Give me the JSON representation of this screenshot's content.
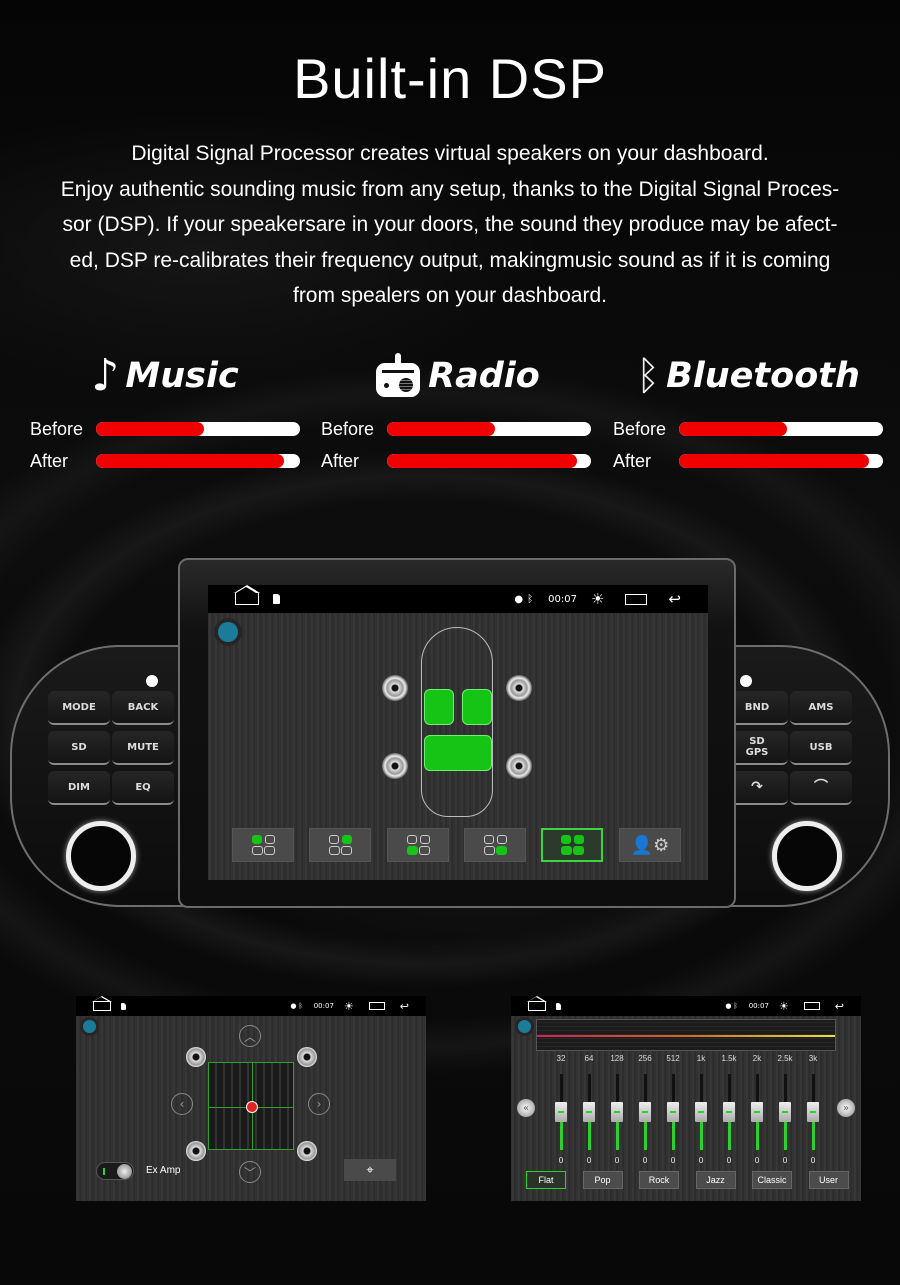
{
  "header": {
    "title": "Built-in DSP",
    "intro_lines": [
      "Digital Signal Processor creates virtual speakers on your dashboard.",
      "Enjoy authentic sounding music from any setup, thanks to the Digital Signal Proces-",
      "sor (DSP).  If your speakersare in your doors, the sound they produce may be afect-",
      "ed, DSP re-calibrates their frequency output, makingmusic sound as if it is coming",
      "from spealers on your dashboard."
    ]
  },
  "features": [
    {
      "title": "Music",
      "icon": "music-note-icon",
      "glyph": "♪",
      "before_label": "Before",
      "after_label": "After",
      "before_pct": 53,
      "after_pct": 92
    },
    {
      "title": "Radio",
      "icon": "radio-icon",
      "glyph": "📻",
      "before_label": "Before",
      "after_label": "After",
      "before_pct": 53,
      "after_pct": 93
    },
    {
      "title": "Bluetooth",
      "icon": "bluetooth-icon",
      "glyph": "ᛒ",
      "before_label": "Before",
      "after_label": "After",
      "before_pct": 53,
      "after_pct": 93
    }
  ],
  "colors": {
    "bar_fill": "#f00000",
    "bar_track": "#ffffff",
    "accent_green": "#16c416",
    "dot_blue": "#1b7c9a"
  },
  "device": {
    "left_buttons": [
      "MODE",
      "BACK",
      "SD",
      "MUTE",
      "DIM",
      "EQ"
    ],
    "right_buttons": [
      "BND",
      "AMS",
      "SD\nGPS",
      "USB",
      "☎ answer",
      "☎ hangup"
    ],
    "right_button_glyphs": [
      "BND",
      "AMS",
      "SD GPS",
      "USB",
      "↷",
      "⌒"
    ]
  },
  "status_bar": {
    "time": "00:07",
    "location_icon": "location-pin-icon",
    "bluetooth_icon": "bluetooth-icon",
    "brightness_icon": "brightness-icon",
    "recents_icon": "recents-icon",
    "back_icon": "back-icon"
  },
  "main_screen": {
    "presets": [
      {
        "name": "front-left",
        "active": false
      },
      {
        "name": "front-right",
        "active": false
      },
      {
        "name": "rear-left",
        "active": false
      },
      {
        "name": "rear-right",
        "active": false
      },
      {
        "name": "all",
        "active": true
      },
      {
        "name": "user-settings",
        "active": false
      }
    ]
  },
  "balance_screen": {
    "ex_amp_label": "Ex Amp",
    "ex_amp_on": true,
    "locate_icon": "crosshair-icon"
  },
  "eq_screen": {
    "bands": [
      {
        "freq": "32",
        "value": "0"
      },
      {
        "freq": "64",
        "value": "0"
      },
      {
        "freq": "128",
        "value": "0"
      },
      {
        "freq": "256",
        "value": "0"
      },
      {
        "freq": "512",
        "value": "0"
      },
      {
        "freq": "1k",
        "value": "0"
      },
      {
        "freq": "1.5k",
        "value": "0"
      },
      {
        "freq": "2k",
        "value": "0"
      },
      {
        "freq": "2.5k",
        "value": "0"
      },
      {
        "freq": "3k",
        "value": "0"
      }
    ],
    "presets": [
      "Flat",
      "Pop",
      "Rock",
      "Jazz",
      "Classic",
      "User"
    ],
    "selected_preset": "Flat"
  }
}
